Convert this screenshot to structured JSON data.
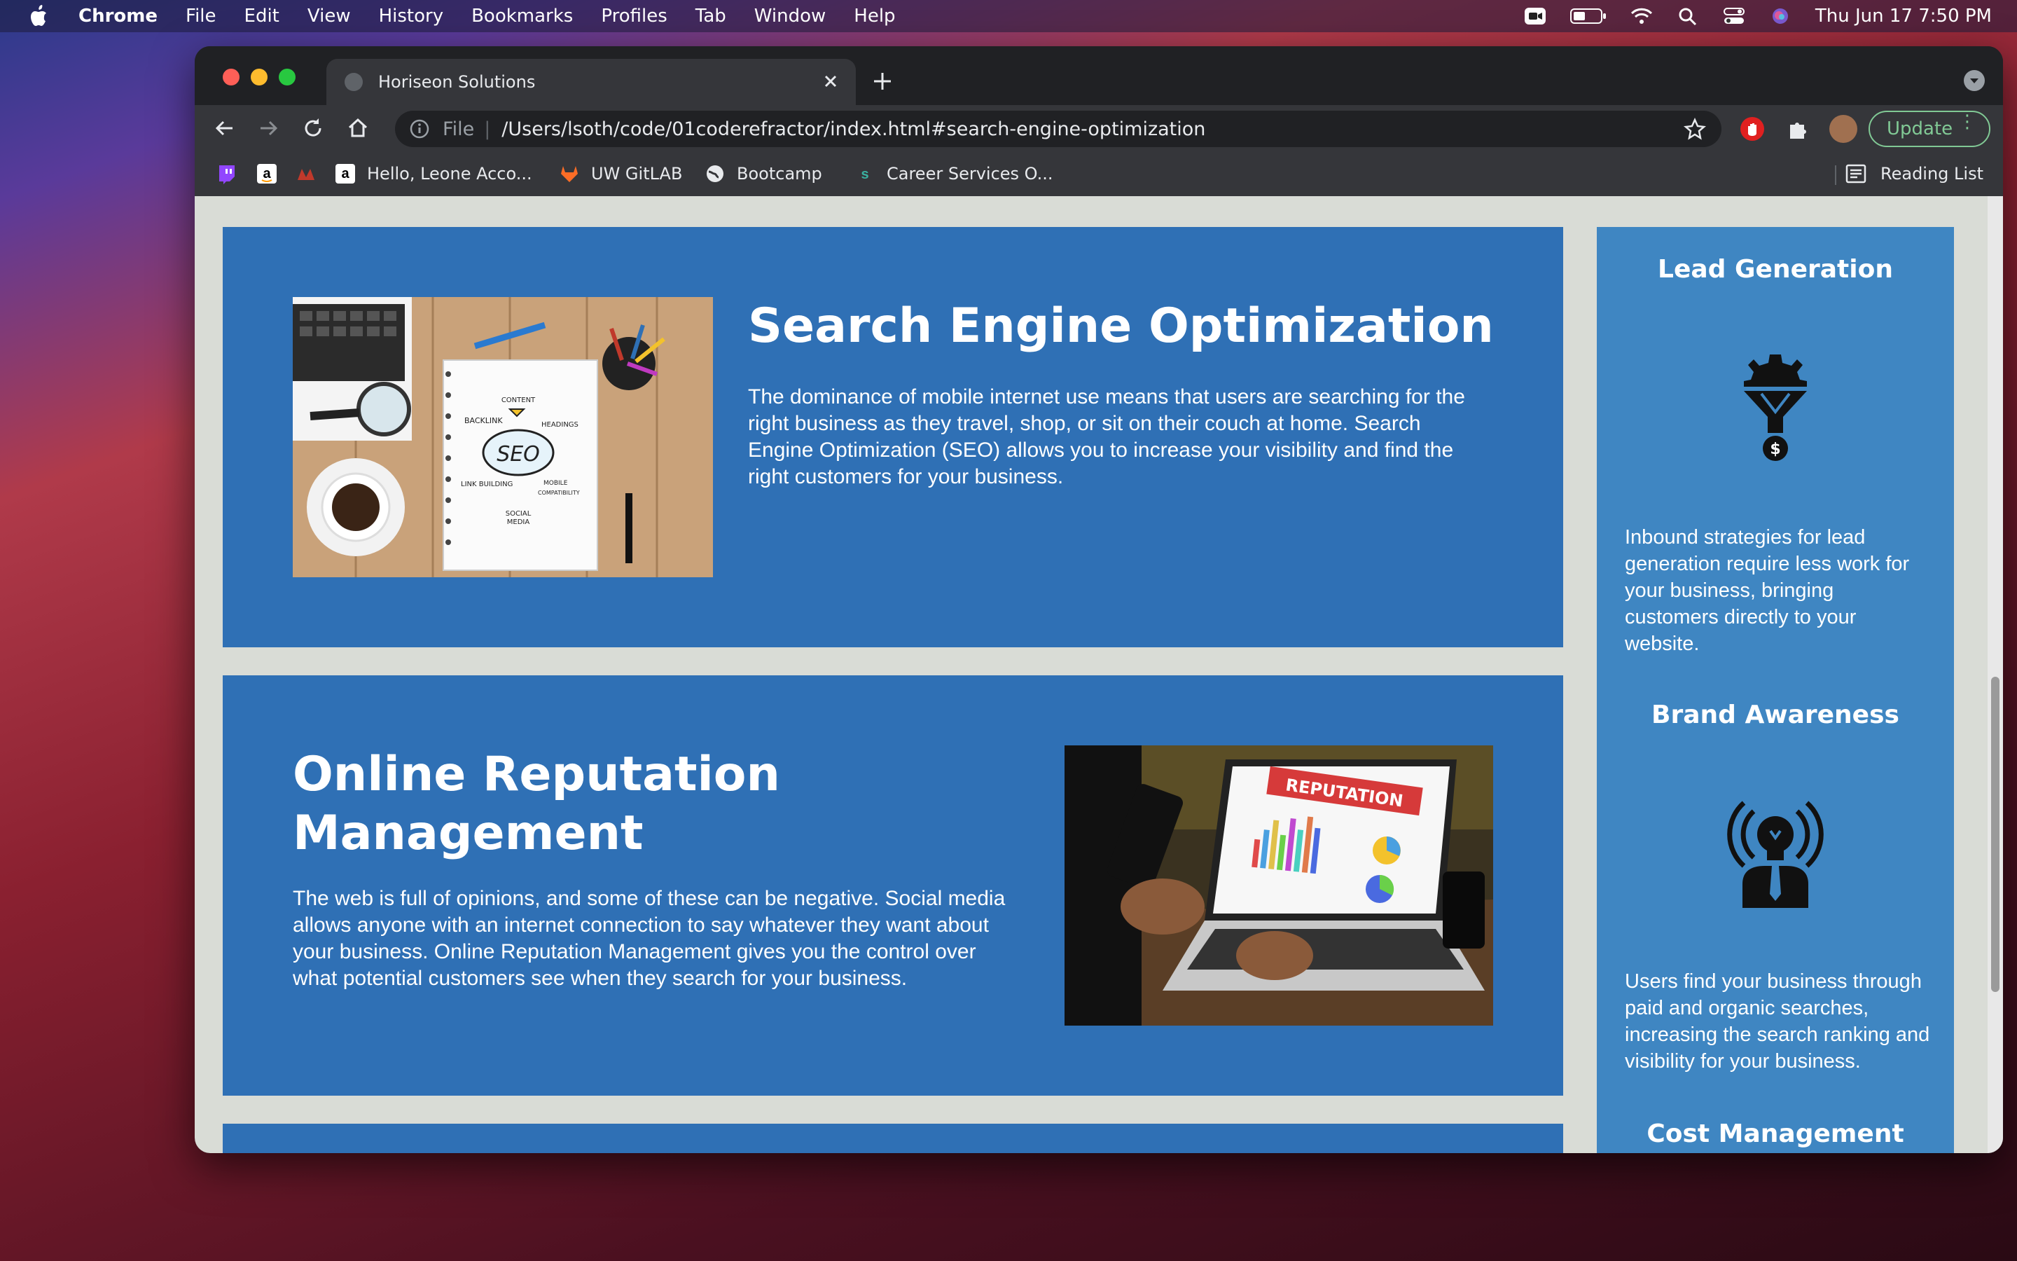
{
  "menubar": {
    "app": "Chrome",
    "items": [
      "File",
      "Edit",
      "View",
      "History",
      "Bookmarks",
      "Profiles",
      "Tab",
      "Window",
      "Help"
    ],
    "datetime": "Thu Jun 17  7:50 PM"
  },
  "tab": {
    "title": "Horiseon Solutions"
  },
  "omnibox": {
    "scheme_label": "File",
    "url": "/Users/lsoth/code/01coderefractor/index.html#search-engine-optimization"
  },
  "update_label": "Update",
  "bookmarks": {
    "hello": "Hello, Leone Acco...",
    "gitlab": "UW GitLAB",
    "bootcamp": "Bootcamp",
    "career": "Career Services O...",
    "reading_list": "Reading List"
  },
  "page": {
    "seo": {
      "title": "Search Engine Optimization",
      "body": "The dominance of mobile internet use means that users are searching for the right business as they travel, shop, or sit on their couch at home. Search Engine Optimization (SEO) allows you to increase your visibility and find the right customers for your business.",
      "image_words": [
        "CONTENT",
        "BACKLINK",
        "HEADINGS",
        "SEO",
        "LINK BUILDING",
        "MOBILE COMPATIBILITY",
        "SOCIAL MEDIA"
      ]
    },
    "orm": {
      "title_line1": "Online Reputation",
      "title_line2": "Management",
      "body": "The web is full of opinions, and some of these can be negative. Social media allows anyone with an internet connection to say whatever they want about your business. Online Reputation Management gives you the control over what potential customers see when they search for your business.",
      "image_banner": "REPUTATION"
    },
    "aside": {
      "lead_title": "Lead Generation",
      "lead_body": "Inbound strategies for lead generation require less work for your business, bringing customers directly to your website.",
      "brand_title": "Brand Awareness",
      "brand_body": "Users find your business through paid and organic searches, increasing the search ranking and visibility for your business.",
      "cost_title": "Cost Management"
    }
  }
}
